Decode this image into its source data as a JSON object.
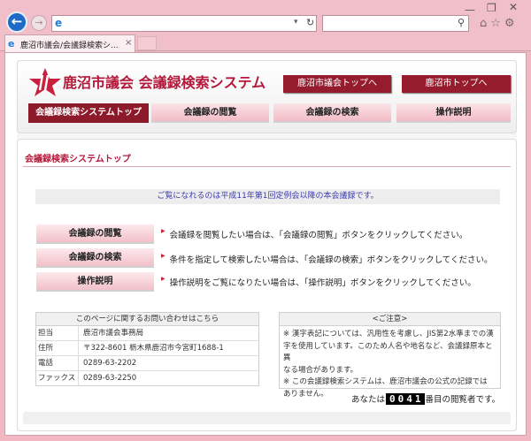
{
  "browser": {
    "address": "",
    "search": "",
    "tab_title": "鹿沼市議会/会議録検索シ...",
    "tab_close": "×",
    "back_glyph": "←",
    "forward_glyph": "→",
    "addr_dropdown": "▾",
    "addr_refresh": "↻",
    "search_glyph": "⚲",
    "win_min": "—",
    "win_max": "❐",
    "win_close": "✕",
    "tool_icons": "⌂☆⚙",
    "icons": [
      "back-arrow-icon",
      "forward-arrow-icon",
      "ie-logo-icon",
      "refresh-icon",
      "search-icon",
      "home-icon",
      "favorites-star-icon",
      "settings-gear-icon"
    ]
  },
  "header": {
    "title": "鹿沼市議会 会議録検索システム",
    "link_gikai": "鹿沼市議会トップへ",
    "link_city": "鹿沼市トップへ",
    "brand_color": "#b4183a"
  },
  "nav": {
    "home": "会議録検索システムトップ",
    "view": "会議録の閲覧",
    "search": "会議録の検索",
    "help": "操作説明"
  },
  "section": {
    "title": "会議録検索システムトップ",
    "notice": "ご覧になれるのは平成11年第1回定例会以降の本会議録です。"
  },
  "actions": [
    {
      "label": "会議録の閲覧",
      "desc": "会議録を閲覧したい場合は、「会議録の閲覧」ボタンをクリックしてください。"
    },
    {
      "label": "会議録の検索",
      "desc": "条件を指定して検索したい場合は、「会議録の検索」ボタンをクリックしてください。"
    },
    {
      "label": "操作説明",
      "desc": "操作説明をご覧になりたい場合は、「操作説明」ボタンをクリックしてください。"
    }
  ],
  "contact": {
    "heading": "このページに関するお問い合わせはこちら",
    "rows": [
      {
        "label": "担当",
        "value": "鹿沼市議会事務局"
      },
      {
        "label": "住所",
        "value": "〒322-8601 栃木県鹿沼市今宮町1688-1"
      },
      {
        "label": "電話",
        "value": "0289-63-2202"
      },
      {
        "label": "ファックス",
        "value": "0289-63-2250"
      }
    ]
  },
  "caution": {
    "heading": "<ご注意>",
    "lines": [
      "※ 漢字表記については、汎用性を考慮し、JIS第2水準までの漢",
      "字を使用しています。このため人名や地名など、会議録原本と異",
      "なる場合があります。",
      "※ この会議録検索システムは、鹿沼市議会の公式の記録では",
      "ありません。"
    ]
  },
  "counter": {
    "prefix": "あなたは",
    "digits": "0041",
    "suffix": "番目の閲覧者です。"
  }
}
